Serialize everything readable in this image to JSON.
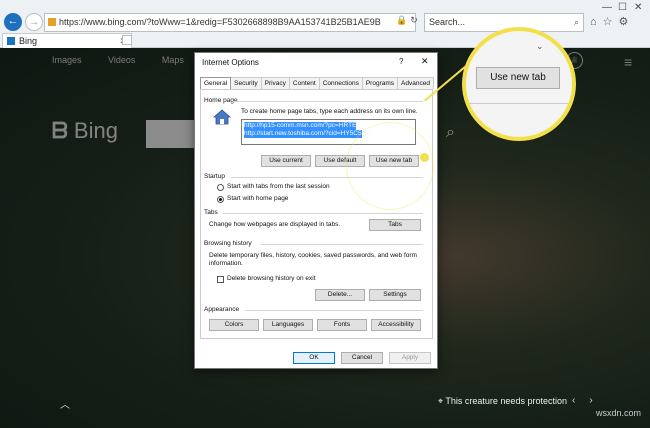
{
  "browser": {
    "address": "https://www.bing.com/?toWww=1&redig=F5302668898B9AA153741B25B1AE9B",
    "search_placeholder": "Search...",
    "tab_title": "Bing",
    "win_min": "—",
    "win_max": "☐",
    "win_close": "✕"
  },
  "bing": {
    "nav": [
      "Images",
      "Videos",
      "Maps"
    ],
    "logo": "Bing",
    "count": "9",
    "footer_note": "This creature needs protection",
    "watermark": "wsxdn.com"
  },
  "dialog": {
    "title": "Internet Options",
    "help": "?",
    "close": "✕",
    "tabs": [
      "General",
      "Security",
      "Privacy",
      "Content",
      "Connections",
      "Programs",
      "Advanced"
    ],
    "home_page": {
      "heading": "Home page",
      "text": "To create home page tabs, type each address on its own line.",
      "urls": [
        "http://hp15-comm.msn.com/?pc=HRTE",
        "http://start.new.toshiba.com/?cid=HY5C5"
      ],
      "use_current": "Use current",
      "use_default": "Use default",
      "use_new_tab": "Use new tab"
    },
    "startup": {
      "heading": "Startup",
      "option1": "Start with tabs from the last session",
      "option2": "Start with home page",
      "selected": "Start with home page"
    },
    "tabs_section": {
      "heading": "Tabs",
      "text": "Change how webpages are displayed in tabs.",
      "button": "Tabs"
    },
    "history": {
      "heading": "Browsing history",
      "text": "Delete temporary files, history, cookies, saved passwords, and web form information.",
      "checkbox": "Delete browsing history on exit",
      "delete": "Delete...",
      "settings": "Settings"
    },
    "appearance": {
      "heading": "Appearance",
      "colors": "Colors",
      "languages": "Languages",
      "fonts": "Fonts",
      "accessibility": "Accessibility"
    },
    "footer": {
      "ok": "OK",
      "cancel": "Cancel",
      "apply": "Apply"
    }
  },
  "callout": {
    "label": "Use new tab",
    "color": "#f2e04a"
  }
}
